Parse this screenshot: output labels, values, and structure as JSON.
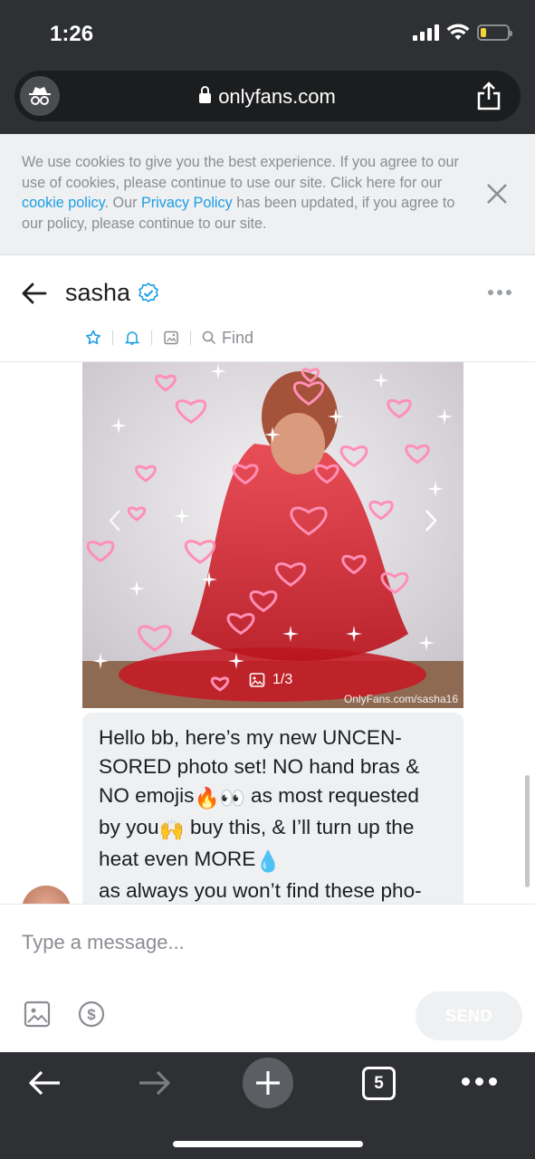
{
  "status_bar": {
    "time": "1:26",
    "battery_level": 0.2,
    "battery_color": "#f5d33c"
  },
  "browser": {
    "url": "onlyfans.com",
    "incognito_icon": "incognito-icon",
    "share_icon": "share-icon",
    "tab_count": "5"
  },
  "cookie_banner": {
    "text_1": "We use cookies to give you the best experience. If you agree to our use of cookies, please continue to use our site. Click here for our ",
    "link_1": "cookie policy",
    "text_2": ". Our ",
    "link_2": "Privacy Policy",
    "text_3": " has been updated, if you agree to our policy, please continue to our site.",
    "link_color": "#1a9ee6"
  },
  "chat": {
    "name": "sasha",
    "toolbar": {
      "find_label": "Find"
    },
    "photo": {
      "counter": "1/3",
      "watermark": "OnlyFans.com/sasha16"
    },
    "message_text": "Hello bb, here’s my new UNCEN-\nSORED photo set! NO hand bras &\nNO emojis",
    "message_emojis_1": "🔥👀",
    "message_text_2": " as most requested\nby you",
    "message_emojis_2": "🙌",
    "message_text_3": " buy this, & I’ll turn up the\nheat even MORE",
    "message_emojis_3": "💧",
    "message_text_4": "\nas always you won’t find these pho-"
  },
  "composer": {
    "placeholder": "Type a message...",
    "send_label": "SEND"
  },
  "colors": {
    "browser_chrome": "#2e3033",
    "accent": "#1a9ee6"
  }
}
